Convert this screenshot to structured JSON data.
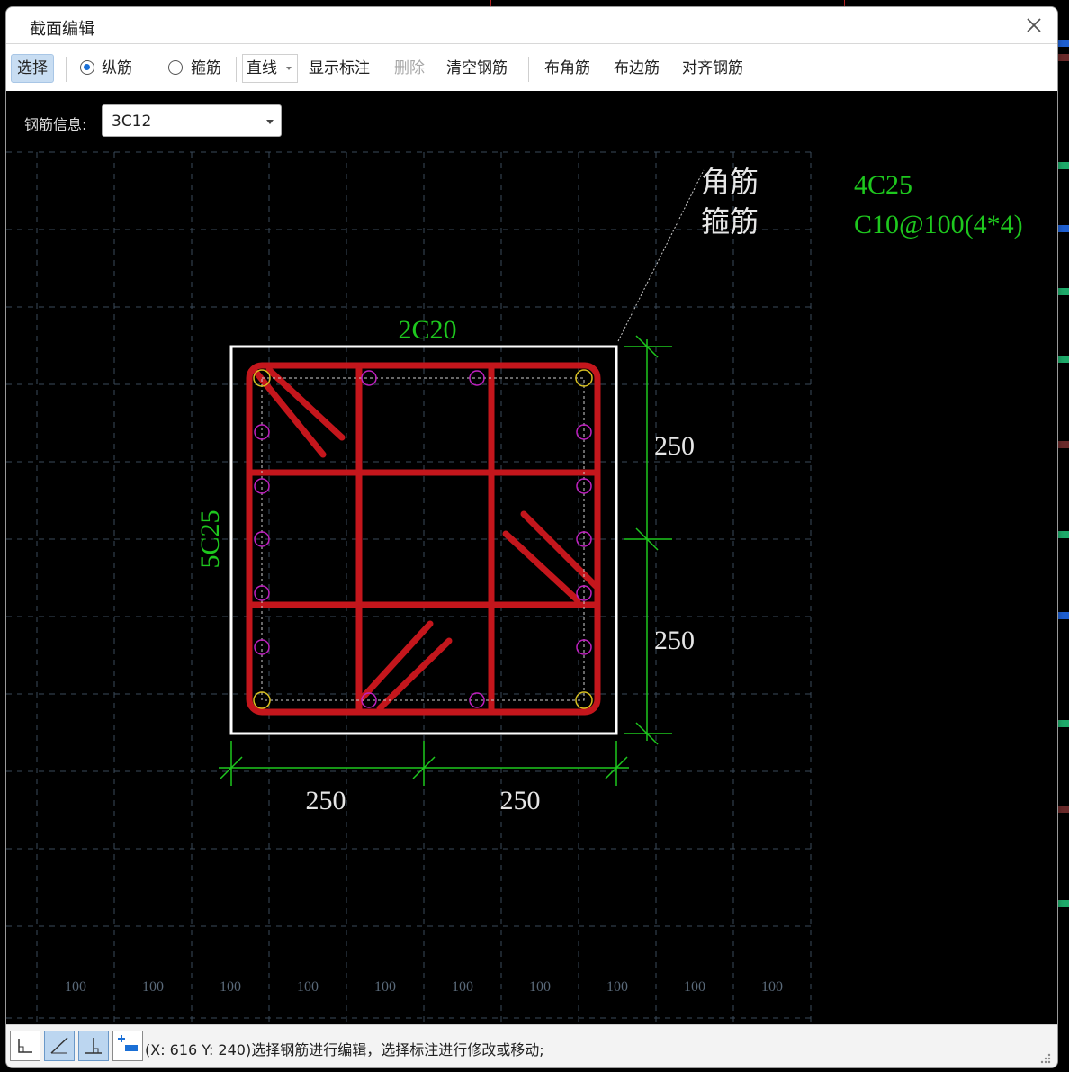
{
  "window": {
    "title": "截面编辑"
  },
  "toolbar": {
    "select": "选择",
    "longitudinal": "纵筋",
    "stirrup": "箍筋",
    "line_mode": "直线",
    "show_labels": "显示标注",
    "delete": "删除",
    "clear_rebar": "清空钢筋",
    "place_corner": "布角筋",
    "place_edge": "布边筋",
    "align_rebar": "对齐钢筋"
  },
  "rebar_info": {
    "label": "钢筋信息:",
    "value": "3C12"
  },
  "drawing": {
    "callout_corner": "角筋",
    "callout_stirrup": "箍筋",
    "corner_spec": "4C25",
    "stirrup_spec": "C10@100(4*4)",
    "top_rebar": "2C20",
    "side_rebar": "5C25",
    "dim_right_top": "250",
    "dim_right_bottom": "250",
    "dim_bottom_left": "250",
    "dim_bottom_right": "250",
    "grid_labels": [
      "100",
      "100",
      "100",
      "100",
      "100",
      "100",
      "100",
      "100",
      "100",
      "100"
    ]
  },
  "colors": {
    "green": "#1ec81e",
    "stirrup_red": "#c4161c",
    "rebar_magenta": "#c020c0",
    "corner_yellow": "#d8c020",
    "grid": "#3a4a5a"
  },
  "status": {
    "text": "(X: 616 Y: 240)选择钢筋进行编辑，选择标注进行修改或移动;",
    "tools": [
      "orthogonal-icon",
      "diagonal-icon",
      "perpendicular-icon",
      "add-offset-icon"
    ]
  }
}
